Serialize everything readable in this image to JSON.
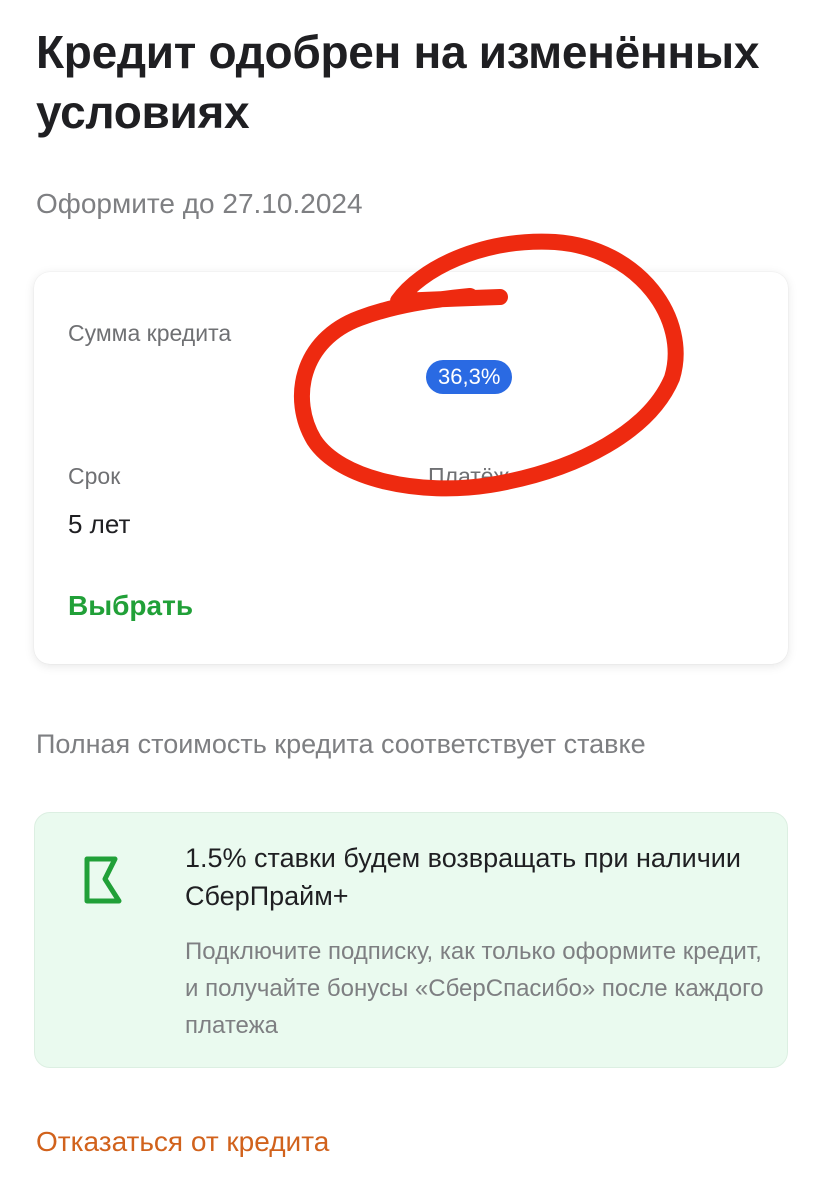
{
  "header": {
    "title": "Кредит одобрен на изменённых условиях",
    "deadline": "Оформите до 27.10.2024"
  },
  "loan_card": {
    "amount_label": "Сумма кредита",
    "rate_badge": "36,3%",
    "term_label": "Срок",
    "term_value": "5 лет",
    "payment_label": "Платёж",
    "choose_button": "Выбрать"
  },
  "psk_note": "Полная стоимость кредита соответствует ставке",
  "promo": {
    "icon": "flag-icon",
    "title": "1.5% ставки будем возвращать при наличии СберПрайм+",
    "description": "Подключите подписку, как только оформите кредит, и получайте бонусы «СберСпасибо» после каждого платежа"
  },
  "footer": {
    "decline_button": "Отказаться от кредита"
  },
  "colors": {
    "brand_green": "#21a038",
    "badge_blue": "#2a6ae3",
    "decline_orange": "#d1621c",
    "annotation_red": "#ee2a10",
    "promo_bg": "#eafaef"
  }
}
